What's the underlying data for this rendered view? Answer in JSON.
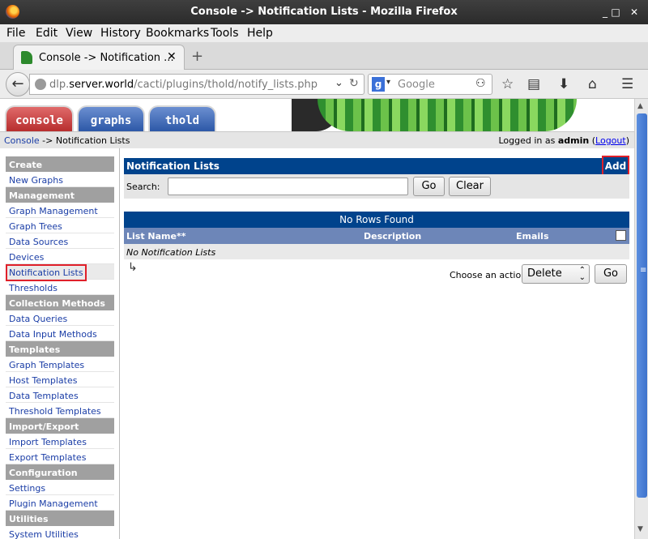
{
  "window": {
    "title": "Console -> Notification Lists - Mozilla Firefox",
    "minimize": "_",
    "maximize": "□",
    "close": "✕"
  },
  "menubar": [
    "File",
    "Edit",
    "View",
    "History",
    "Bookmarks",
    "Tools",
    "Help"
  ],
  "tab": {
    "label": "Console -> Notification ...",
    "close": "✕",
    "new_tab": "+"
  },
  "navbar": {
    "back": "←",
    "url_prefix": "dlp.",
    "url_host": "server.world",
    "url_path": "/cacti/plugins/thold/notify_lists.php",
    "search_engine": "g",
    "search_placeholder": "Google",
    "icons": [
      "bookmark-star-icon",
      "reading-list-icon",
      "download-icon",
      "home-icon",
      "hamburger-menu-icon"
    ]
  },
  "cacti": {
    "tabs": [
      "console",
      "graphs",
      "thold"
    ],
    "breadcrumb_link": "Console",
    "breadcrumb_rest": "-> Notification Lists",
    "login_prefix": "Logged in as ",
    "login_user": "admin",
    "logout": "Logout",
    "menu": [
      {
        "type": "head",
        "label": "Create"
      },
      {
        "type": "item",
        "label": "New Graphs"
      },
      {
        "type": "head",
        "label": "Management"
      },
      {
        "type": "item",
        "label": "Graph Management"
      },
      {
        "type": "item",
        "label": "Graph Trees"
      },
      {
        "type": "item",
        "label": "Data Sources"
      },
      {
        "type": "item",
        "label": "Devices"
      },
      {
        "type": "item",
        "label": "Notification Lists",
        "selected": true
      },
      {
        "type": "item",
        "label": "Thresholds"
      },
      {
        "type": "head",
        "label": "Collection Methods"
      },
      {
        "type": "item",
        "label": "Data Queries"
      },
      {
        "type": "item",
        "label": "Data Input Methods"
      },
      {
        "type": "head",
        "label": "Templates"
      },
      {
        "type": "item",
        "label": "Graph Templates"
      },
      {
        "type": "item",
        "label": "Host Templates"
      },
      {
        "type": "item",
        "label": "Data Templates"
      },
      {
        "type": "item",
        "label": "Threshold Templates"
      },
      {
        "type": "head",
        "label": "Import/Export"
      },
      {
        "type": "item",
        "label": "Import Templates"
      },
      {
        "type": "item",
        "label": "Export Templates"
      },
      {
        "type": "head",
        "label": "Configuration"
      },
      {
        "type": "item",
        "label": "Settings"
      },
      {
        "type": "item",
        "label": "Plugin Management"
      },
      {
        "type": "head",
        "label": "Utilities"
      },
      {
        "type": "item",
        "label": "System Utilities"
      }
    ],
    "panel": {
      "title": "Notification Lists",
      "add": "Add",
      "search_label": "Search:",
      "search_value": "",
      "go": "Go",
      "clear": "Clear"
    },
    "table": {
      "no_rows": "No Rows Found",
      "columns": [
        "List Name**",
        "Description",
        "Emails"
      ],
      "empty_text": "No Notification Lists"
    },
    "action": {
      "label": "Choose an action:",
      "selected": "Delete",
      "go": "Go"
    }
  }
}
